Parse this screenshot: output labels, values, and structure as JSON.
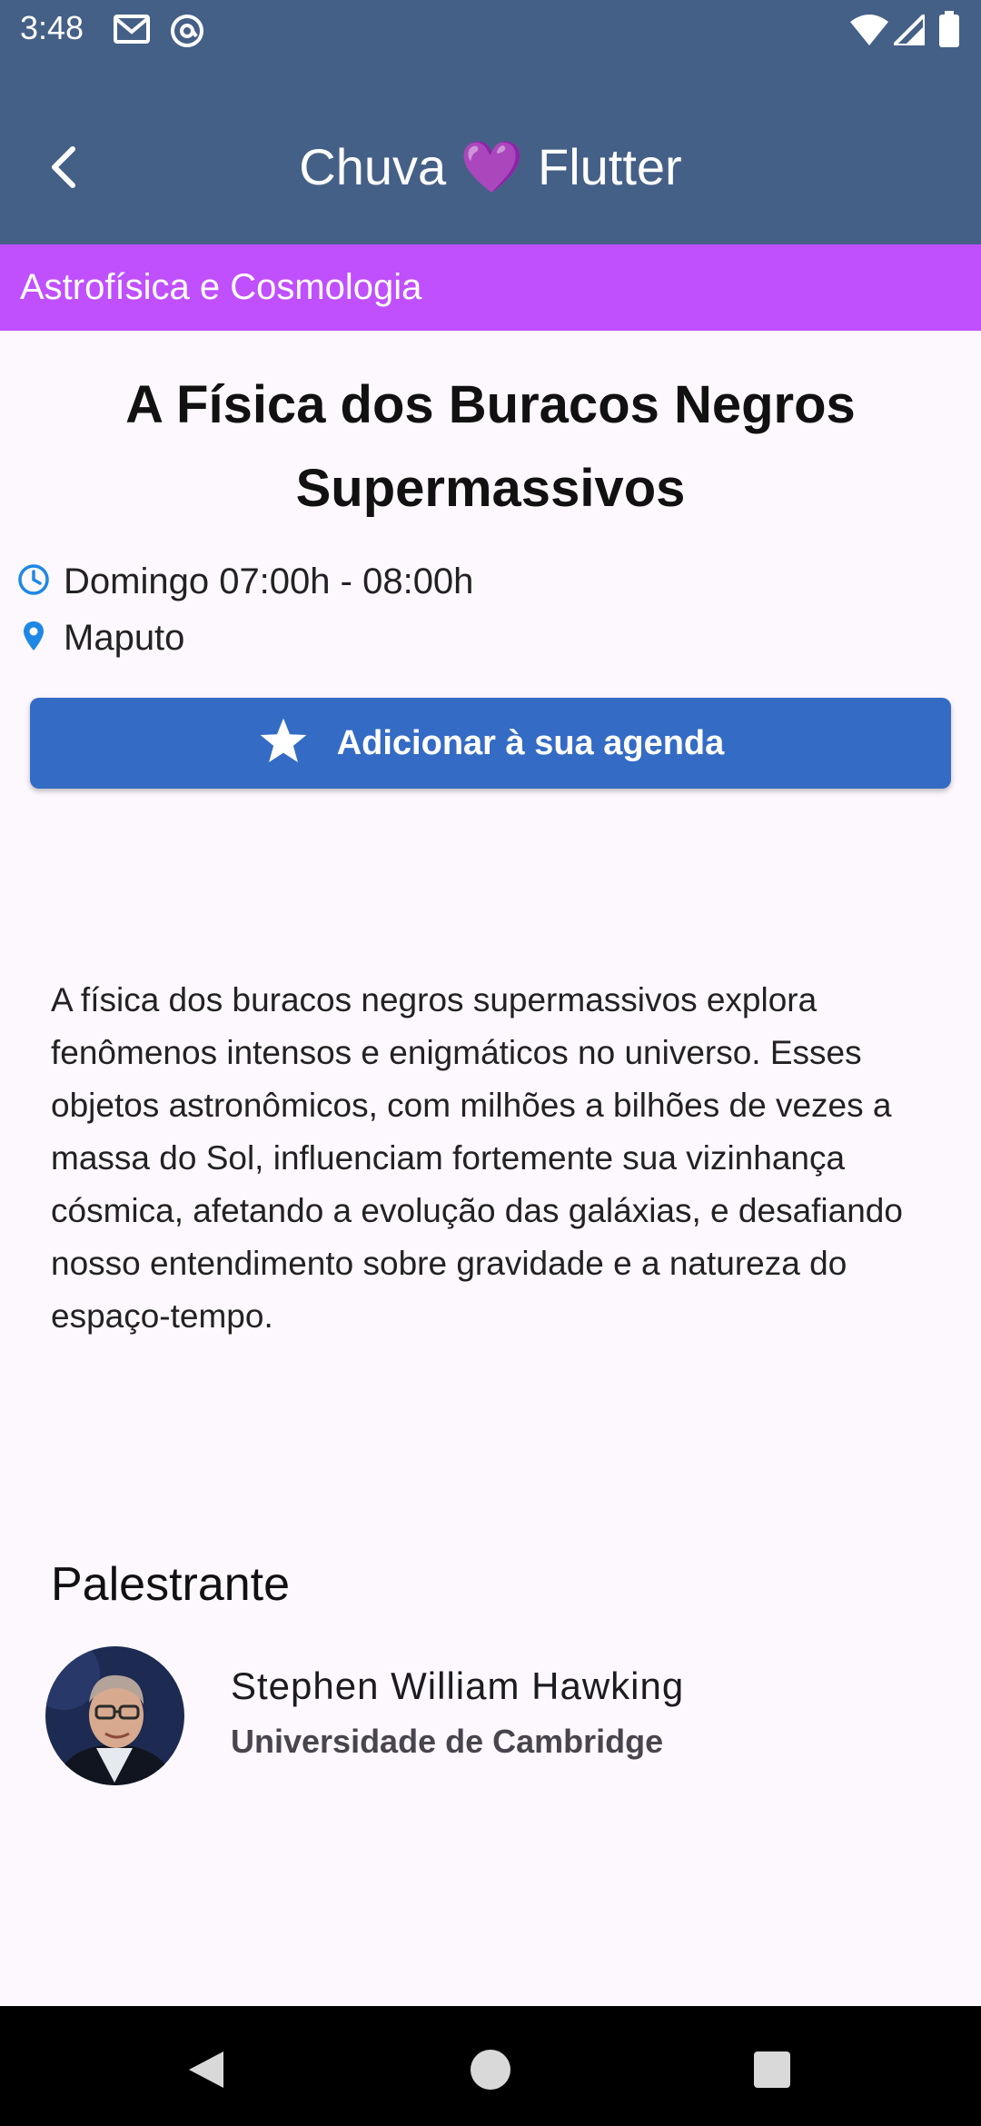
{
  "status_bar": {
    "time": "3:48",
    "left_icons": [
      "gmail-icon",
      "at-sign-icon"
    ],
    "right_icons": [
      "wifi-icon",
      "signal-icon",
      "battery-icon"
    ]
  },
  "app_bar": {
    "title": "Chuva 💜 Flutter",
    "back_icon": "chevron-left-icon",
    "background": "#456087"
  },
  "category": {
    "label": "Astrofísica e Cosmologia",
    "color": "#c04ffe"
  },
  "session": {
    "title": "A Física dos Buracos Negros Supermassivos",
    "time": "Domingo 07:00h - 08:00h",
    "location": "Maputo",
    "add_button_label": "Adicionar à sua agenda",
    "accent": "#346bc4",
    "description": "A física dos buracos negros supermassivos explora fenômenos intensos e enigmáticos no universo. Esses objetos astronômicos, com milhões a bilhões de vezes a massa do Sol, influenciam fortemente sua vizinhança cósmica, afetando a evolução das galáxias, e desafiando nosso entendimento sobre gravidade e a natureza do espaço-tempo."
  },
  "speaker_section": {
    "heading": "Palestrante",
    "speakers": [
      {
        "name": "Stephen William Hawking",
        "affiliation": "Universidade de Cambridge"
      }
    ]
  },
  "nav_bar": {
    "buttons": [
      "back-triangle-icon",
      "home-circle-icon",
      "recents-square-icon"
    ]
  }
}
